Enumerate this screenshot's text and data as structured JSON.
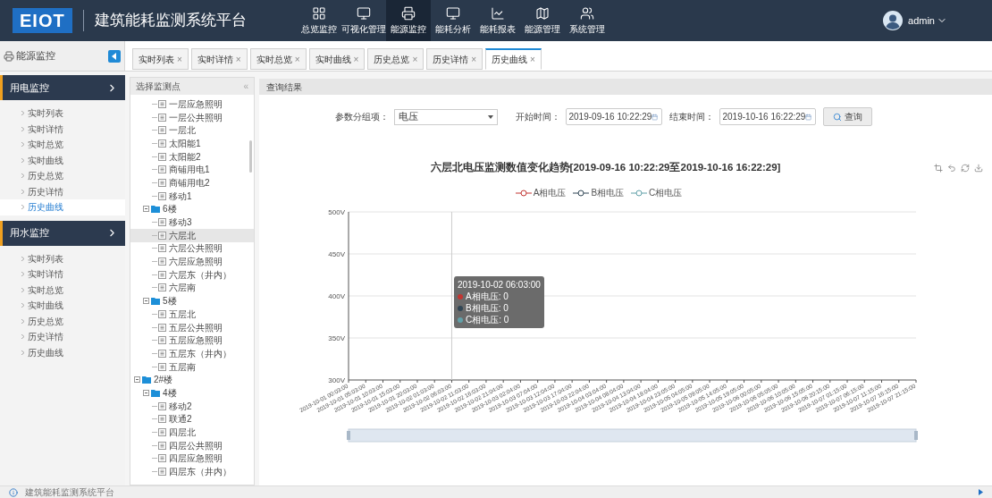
{
  "header": {
    "logo": "EIOT",
    "title": "建筑能耗监测系统平台",
    "nav": [
      {
        "label": "总览监控",
        "selected": false,
        "kind": "grid"
      },
      {
        "label": "可视化管理",
        "selected": false,
        "kind": "screen"
      },
      {
        "label": "能源监控",
        "selected": true,
        "kind": "printer"
      },
      {
        "label": "能耗分析",
        "selected": false,
        "kind": "screen"
      },
      {
        "label": "能耗报表",
        "selected": false,
        "kind": "chart"
      },
      {
        "label": "能源管理",
        "selected": false,
        "kind": "map"
      },
      {
        "label": "系统管理",
        "selected": false,
        "kind": "users"
      }
    ],
    "user": "admin"
  },
  "sidebar": {
    "title": "能源监控",
    "groups": [
      {
        "title": "用电监控",
        "expanded": true,
        "items": [
          {
            "label": "实时列表",
            "selected": false
          },
          {
            "label": "实时详情",
            "selected": false
          },
          {
            "label": "实时总览",
            "selected": false
          },
          {
            "label": "实时曲线",
            "selected": false
          },
          {
            "label": "历史总览",
            "selected": false
          },
          {
            "label": "历史详情",
            "selected": false
          },
          {
            "label": "历史曲线",
            "selected": true
          }
        ]
      },
      {
        "title": "用水监控",
        "expanded": true,
        "items": [
          {
            "label": "实时列表",
            "selected": false
          },
          {
            "label": "实时详情",
            "selected": false
          },
          {
            "label": "实时总览",
            "selected": false
          },
          {
            "label": "实时曲线",
            "selected": false
          },
          {
            "label": "历史总览",
            "selected": false
          },
          {
            "label": "历史详情",
            "selected": false
          },
          {
            "label": "历史曲线",
            "selected": false
          }
        ]
      }
    ]
  },
  "tabs": [
    {
      "label": "实时列表",
      "close": "×",
      "selected": false
    },
    {
      "label": "实时详情",
      "close": "×",
      "selected": false
    },
    {
      "label": "实时总览",
      "close": "×",
      "selected": false
    },
    {
      "label": "实时曲线",
      "close": "×",
      "selected": false
    },
    {
      "label": "历史总览",
      "close": "×",
      "selected": false
    },
    {
      "label": "历史详情",
      "close": "×",
      "selected": false
    },
    {
      "label": "历史曲线",
      "close": "×",
      "selected": true
    }
  ],
  "tree": {
    "title": "选择监测点",
    "collapse": "«",
    "nodes": [
      {
        "children": [
          {
            "children": [
              {
                "label": "一层应急照明",
                "selected": false
              },
              {
                "label": "一层公共照明",
                "selected": false
              },
              {
                "label": "一层北",
                "selected": false
              },
              {
                "label": "太阳能1",
                "selected": false
              },
              {
                "label": "太阳能2",
                "selected": false
              },
              {
                "label": "商铺用电1",
                "selected": false
              },
              {
                "label": "商铺用电2",
                "selected": false
              },
              {
                "label": "移动1",
                "selected": false
              }
            ]
          },
          {
            "label": "6楼",
            "expanded": true,
            "children": [
              {
                "label": "移动3",
                "selected": false
              },
              {
                "label": "六层北",
                "selected": true
              },
              {
                "label": "六层公共照明",
                "selected": false
              },
              {
                "label": "六层应急照明",
                "selected": false
              },
              {
                "label": "六层东（井内）",
                "selected": false
              },
              {
                "label": "六层南",
                "selected": false
              }
            ]
          },
          {
            "label": "5楼",
            "expanded": true,
            "children": [
              {
                "label": "五层北",
                "selected": false
              },
              {
                "label": "五层公共照明",
                "selected": false
              },
              {
                "label": "五层应急照明",
                "selected": false
              },
              {
                "label": "五层东（井内）",
                "selected": false
              },
              {
                "label": "五层南",
                "selected": false
              }
            ]
          }
        ]
      },
      {
        "label": "2#楼",
        "expanded": true,
        "children": [
          {
            "label": "4楼",
            "expanded": true,
            "children": [
              {
                "label": "移动2",
                "selected": false
              },
              {
                "label": "联通2",
                "selected": false
              },
              {
                "label": "四层北",
                "selected": false
              },
              {
                "label": "四层公共照明",
                "selected": false
              },
              {
                "label": "四层应急照明",
                "selected": false
              },
              {
                "label": "四层东（井内）",
                "selected": false
              }
            ]
          }
        ]
      }
    ]
  },
  "results": {
    "title": "查询结果",
    "form": {
      "param_label": "参数分组项：",
      "param_value": "电压",
      "start_label": "开始时间：",
      "start_value": "2019-09-16 10:22:29",
      "end_label": "结束时间：",
      "end_value": "2019-10-16 16:22:29",
      "button": "查询"
    },
    "chart_data": {
      "type": "line",
      "title": "六层北电压监测数值变化趋势[2019-09-16 10:22:29至2019-10-16 16:22:29]",
      "categories": [
        "2019-10-01 00:03:00",
        "2019-10-01 05:03:00",
        "2019-10-01 10:03:00",
        "2019-10-01 15:03:00",
        "2019-10-01 20:03:00",
        "2019-10-02 01:03:00",
        "2019-10-02 06:03:00",
        "2019-10-02 11:03:00",
        "2019-10-02 16:03:00",
        "2019-10-02 21:04:00",
        "2019-10-03 02:04:00",
        "2019-10-03 07:04:00",
        "2019-10-03 12:04:00",
        "2019-10-03 17:04:00",
        "2019-10-03 22:04:00",
        "2019-10-04 03:04:00",
        "2019-10-04 08:04:00",
        "2019-10-04 13:04:00",
        "2019-10-04 18:04:00",
        "2019-10-04 23:05:00",
        "2019-10-05 04:05:00",
        "2019-10-05 09:05:00",
        "2019-10-05 14:05:00",
        "2019-10-05 19:05:00",
        "2019-10-06 00:05:00",
        "2019-10-06 05:05:00",
        "2019-10-06 10:05:00",
        "2019-10-06 15:05:00",
        "2019-10-06 20:15:00",
        "2019-10-07 01:15:00",
        "2019-10-07 06:15:00",
        "2019-10-07 11:15:00",
        "2019-10-07 16:15:00",
        "2019-10-07 21:15:00"
      ],
      "grid": true,
      "ref_lines": [
        {
          "axis": "x",
          "value": "2019-10-02 06:03:00",
          "color": "#cccccc"
        }
      ],
      "ylim": [
        300,
        500
      ],
      "yticks": [
        {
          "value": 300,
          "label": "300V"
        },
        {
          "value": 350,
          "label": "350V"
        },
        {
          "value": 400,
          "label": "400V"
        },
        {
          "value": 450,
          "label": "450V"
        },
        {
          "value": 500,
          "label": "500V"
        }
      ],
      "series": [
        {
          "name": "A相电压",
          "color": "#c23531",
          "values": [
            null,
            null,
            null,
            null,
            null,
            null,
            null,
            null,
            null,
            null,
            null,
            null,
            null,
            null,
            null,
            null,
            null,
            null,
            null,
            null,
            null,
            null,
            null,
            null,
            null,
            null,
            null,
            null,
            null,
            null,
            null,
            null,
            null,
            null
          ]
        },
        {
          "name": "B相电压",
          "color": "#2f4554",
          "values": [
            null,
            null,
            null,
            null,
            null,
            null,
            null,
            null,
            null,
            null,
            null,
            null,
            null,
            null,
            null,
            null,
            null,
            null,
            null,
            null,
            null,
            null,
            null,
            null,
            null,
            null,
            null,
            null,
            null,
            null,
            null,
            null,
            null,
            null
          ]
        },
        {
          "name": "C相电压",
          "color": "#61a0a8",
          "values": [
            null,
            null,
            null,
            null,
            null,
            null,
            null,
            null,
            null,
            null,
            null,
            null,
            null,
            null,
            null,
            null,
            null,
            null,
            null,
            null,
            null,
            null,
            null,
            null,
            null,
            null,
            null,
            null,
            null,
            null,
            null,
            null,
            null,
            null
          ]
        }
      ]
    },
    "tooltip": {
      "title": "2019-10-02 06:03:00",
      "items": [
        "A相电压: 0",
        "B相电压: 0",
        "C相电压: 0"
      ]
    }
  },
  "status_bar": {
    "text": "建筑能耗监测系统平台"
  }
}
